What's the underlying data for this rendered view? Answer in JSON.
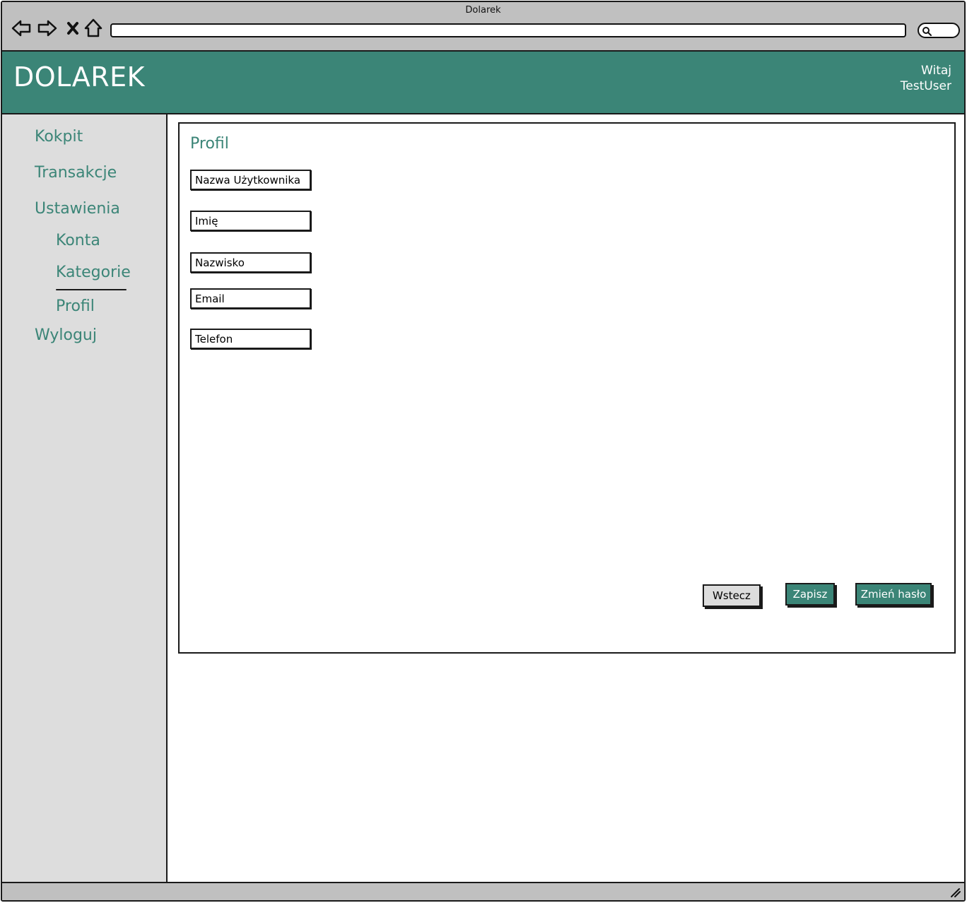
{
  "window": {
    "title": "Dolarek"
  },
  "header": {
    "brand": "DOLAREK",
    "greeting_line1": "Witaj",
    "greeting_line2": "TestUser"
  },
  "sidebar": {
    "items": [
      {
        "label": "Kokpit"
      },
      {
        "label": "Transakcje"
      },
      {
        "label": "Ustawienia"
      },
      {
        "label": "Konta"
      },
      {
        "label": "Kategorie"
      },
      {
        "label": "Profil"
      },
      {
        "label": "Wyloguj"
      }
    ]
  },
  "main": {
    "title": "Profil",
    "fields": [
      {
        "placeholder": "Nazwa Użytkownika"
      },
      {
        "placeholder": "Imię"
      },
      {
        "placeholder": "Nazwisko"
      },
      {
        "placeholder": "Email"
      },
      {
        "placeholder": "Telefon"
      }
    ],
    "buttons": {
      "back": "Wstecz",
      "save": "Zapisz",
      "change_password": "Zmień hasło"
    }
  },
  "colors": {
    "accent": "#3b8577",
    "sidebar_bg": "#dddddd",
    "chrome_bg": "#c0c0c0"
  }
}
